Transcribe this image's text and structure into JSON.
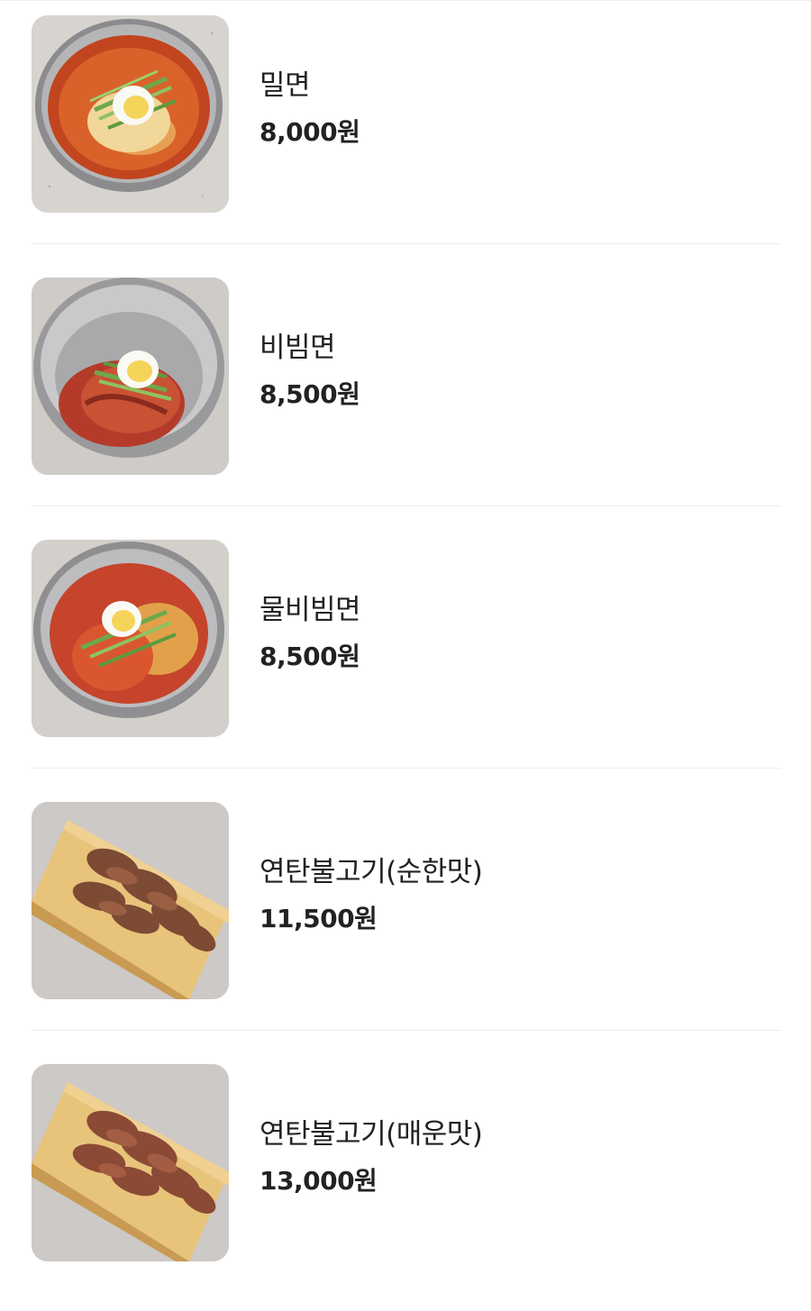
{
  "menu": {
    "items": [
      {
        "name": "밀면",
        "price": "8,000원",
        "image": "mil-myeon-photo",
        "dish": "cold-broth-noodles"
      },
      {
        "name": "비빔면",
        "price": "8,500원",
        "image": "bibim-myeon-photo",
        "dish": "spicy-mixed-noodles"
      },
      {
        "name": "물비빔면",
        "price": "8,500원",
        "image": "mul-bibim-myeon-photo",
        "dish": "spicy-broth-noodles"
      },
      {
        "name": "연탄불고기(순한맛)",
        "price": "11,500원",
        "image": "bulgogi-mild-photo",
        "dish": "grilled-bulgogi"
      },
      {
        "name": "연탄불고기(매운맛)",
        "price": "13,000원",
        "image": "bulgogi-spicy-photo",
        "dish": "grilled-bulgogi"
      }
    ]
  },
  "colors": {
    "text": "#222222",
    "divider": "#efefef",
    "background": "#ffffff",
    "countertop": "#d9d6d3"
  }
}
